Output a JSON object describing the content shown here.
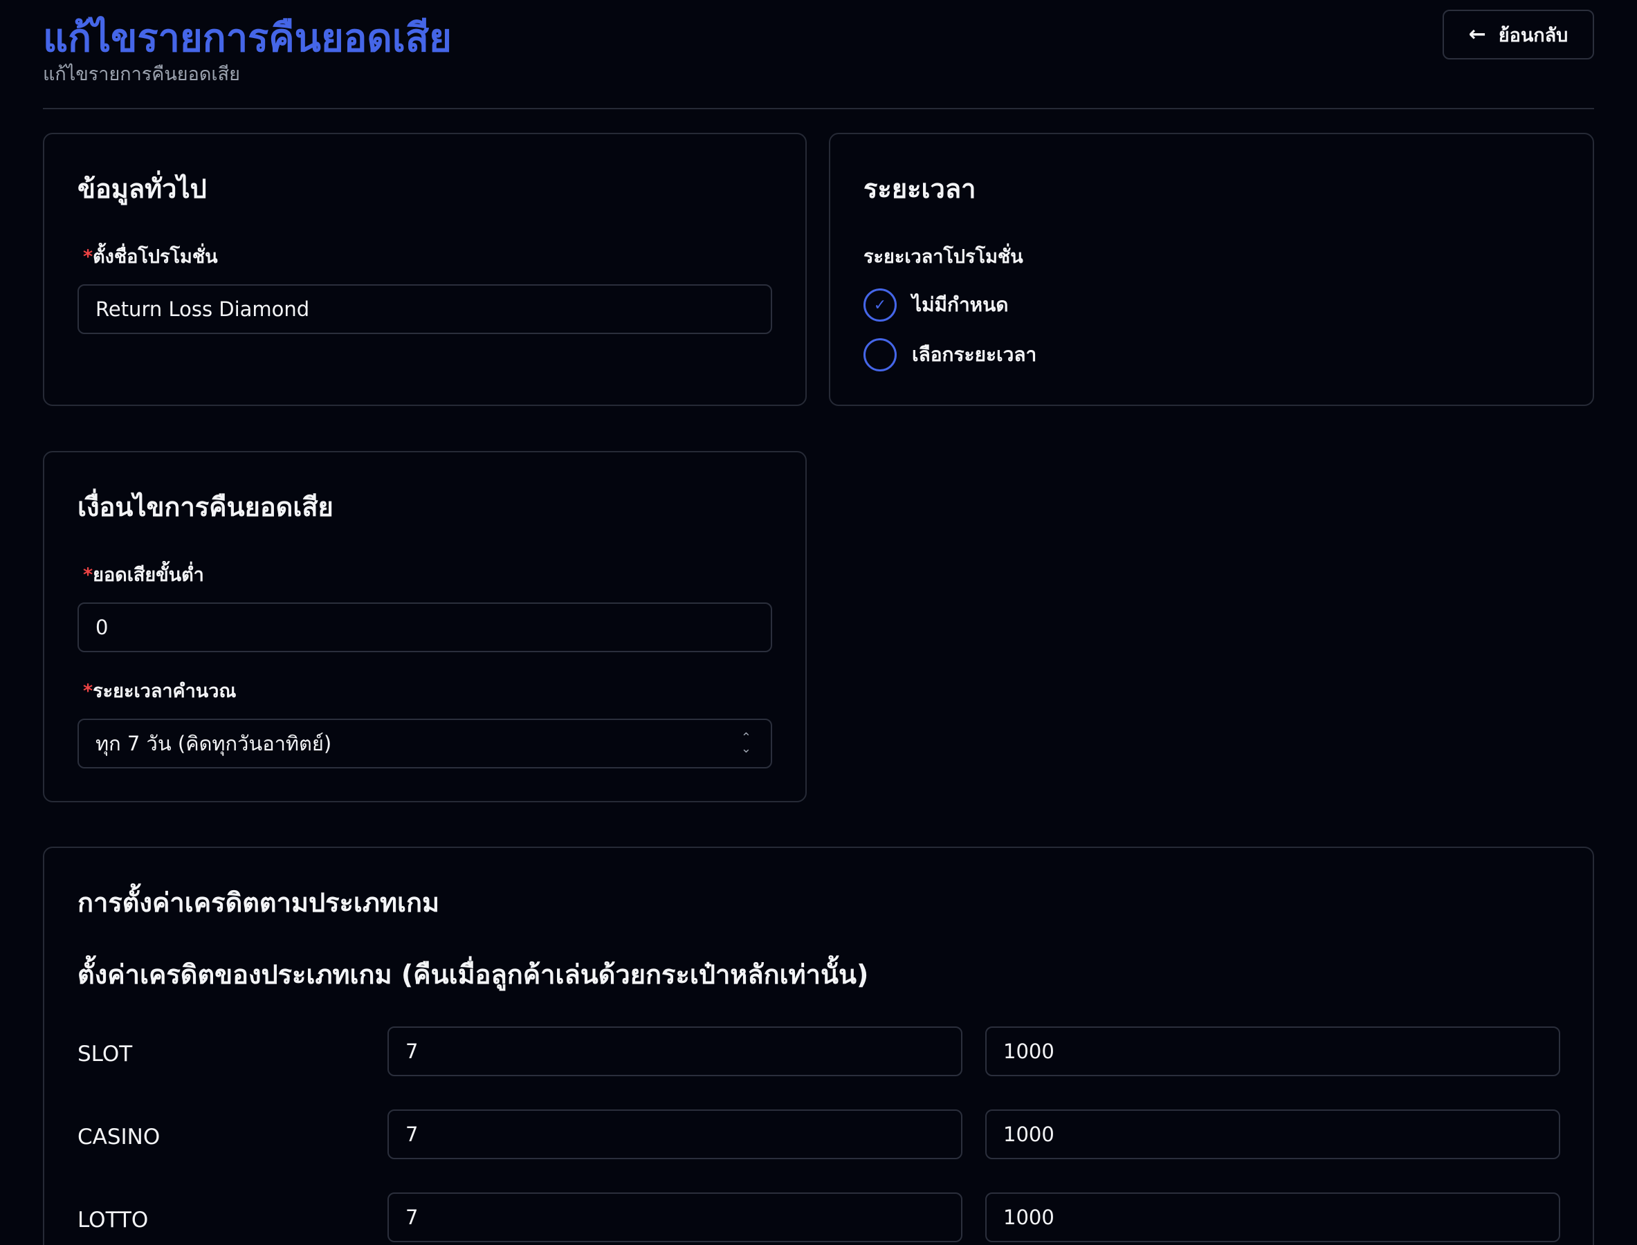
{
  "header": {
    "title": "แก้ไขรายการคืนยอดเสีย",
    "subtitle": "แก้ไขรายการคืนยอดเสีย",
    "back_label": "ย้อนกลับ"
  },
  "general": {
    "title": "ข้อมูลทั่วไป",
    "name_label": "ตั้งชื่อโปรโมชั่น",
    "name_value": "Return Loss Diamond"
  },
  "period": {
    "title": "ระยะเวลา",
    "label": "ระยะเวลาโปรโมชั่น",
    "options": [
      {
        "label": "ไม่มีกำหนด",
        "selected": true
      },
      {
        "label": "เลือกระยะเวลา",
        "selected": false
      }
    ]
  },
  "conditions": {
    "title": "เงื่อนไขการคืนยอดเสีย",
    "min_loss_label": "ยอดเสียขั้นต่ำ",
    "min_loss_value": "0",
    "calc_period_label": "ระยะเวลาคำนวณ",
    "calc_period_value": "ทุก 7 วัน (คิดทุกวันอาทิตย์)"
  },
  "credit": {
    "title": "การตั้งค่าเครดิตตามประเภทเกม",
    "subtitle": "ตั้งค่าเครดิตของประเภทเกม (คืนเมื่อลูกค้าเล่นด้วยกระเป๋าหลักเท่านั้น)",
    "rows": [
      {
        "game": "SLOT",
        "percent": "7",
        "max": "1000"
      },
      {
        "game": "CASINO",
        "percent": "7",
        "max": "1000"
      },
      {
        "game": "LOTTO",
        "percent": "7",
        "max": "1000"
      }
    ]
  },
  "colors": {
    "accent": "#4566e8",
    "required": "#ef4444",
    "background": "#03050e",
    "border": "#262a36"
  },
  "icons": {
    "back": "arrow-left-icon",
    "check": "check-icon",
    "select": "chevron-up-down-icon"
  }
}
